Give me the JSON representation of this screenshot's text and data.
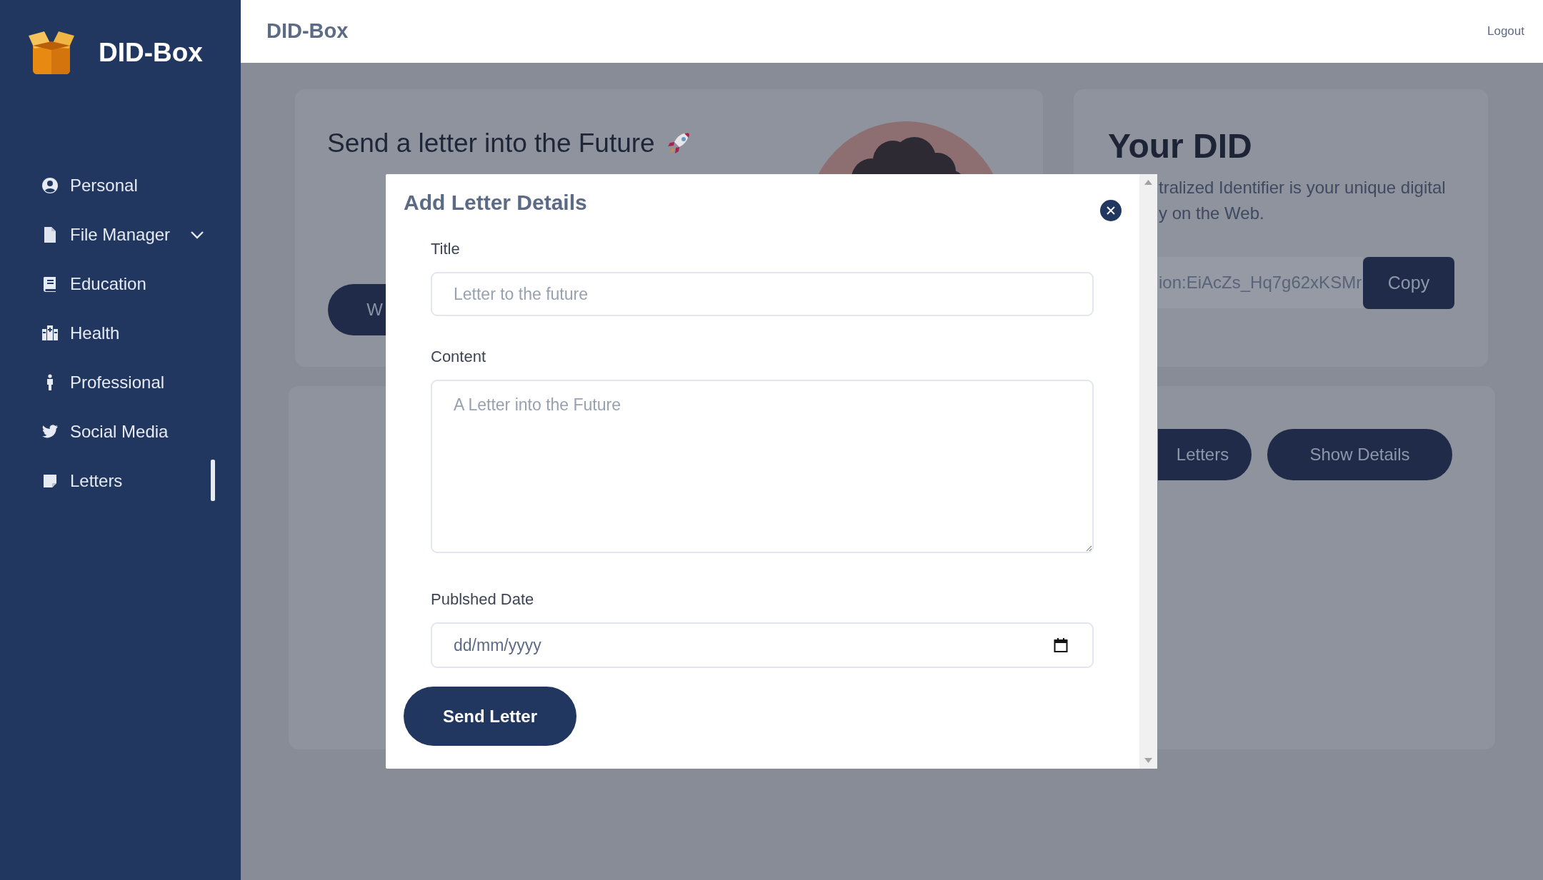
{
  "sidebar": {
    "logo": "DID-Box",
    "items": [
      {
        "label": "Personal",
        "kind": "link",
        "selected": false
      },
      {
        "label": "File Manager",
        "kind": "dropdown",
        "expanded": false,
        "selected": false
      },
      {
        "label": "Education",
        "kind": "link",
        "selected": false
      },
      {
        "label": "Health",
        "kind": "link",
        "selected": false
      },
      {
        "label": "Professional",
        "kind": "link",
        "selected": false
      },
      {
        "label": "Social Media",
        "kind": "link",
        "selected": false
      },
      {
        "label": "Letters",
        "kind": "link",
        "selected": true
      }
    ]
  },
  "header": {
    "title": "DID-Box",
    "logout": "Logout"
  },
  "letter_card": {
    "title": "Send a letter into the Future",
    "button": "W"
  },
  "did_card": {
    "title": "Your DID",
    "description_lines": [
      "tralized Identifier is your unique digital",
      "y on the Web."
    ],
    "did_value": "ion:EiAcZs_Hq7g62xKSMr",
    "copy_button": "Copy"
  },
  "letters_card": {
    "buttons": [
      "Letters",
      "Show Details"
    ]
  },
  "modal": {
    "title": "Add Letter Details",
    "fields": [
      {
        "label": "Title",
        "kind": "text",
        "placeholder": "Letter to the future"
      },
      {
        "label": "Content",
        "kind": "textarea",
        "placeholder": "A Letter into the Future"
      },
      {
        "label": "Publshed Date",
        "kind": "date",
        "placeholder": "dd/mm/yyyy"
      }
    ],
    "submit": "Send Letter"
  }
}
